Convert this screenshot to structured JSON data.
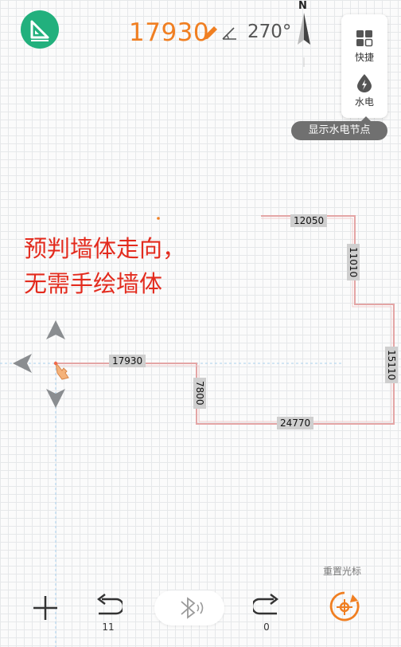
{
  "header": {
    "wall_length": "17930",
    "angle": "270°",
    "compass_label": "N"
  },
  "side_panel": {
    "shortcut_label": "快捷",
    "utility_label": "水电",
    "tooltip": "显示水电节点"
  },
  "canvas": {
    "caption_line1": "预判墙体走向，",
    "caption_line2": "无需手绘墙体",
    "walls": {
      "top": "12050",
      "right_upper": "11010",
      "right": "15110",
      "bottom": "24770",
      "left_vertical": "7800",
      "current": "17930"
    }
  },
  "footer": {
    "reset_cursor_label": "重置光标",
    "undo_count": "11",
    "redo_count": "0"
  },
  "colors": {
    "accent": "#f07f22",
    "brand_green": "#22b07d",
    "caption_red": "#e32b1e",
    "wall": "#e4a5a5"
  }
}
